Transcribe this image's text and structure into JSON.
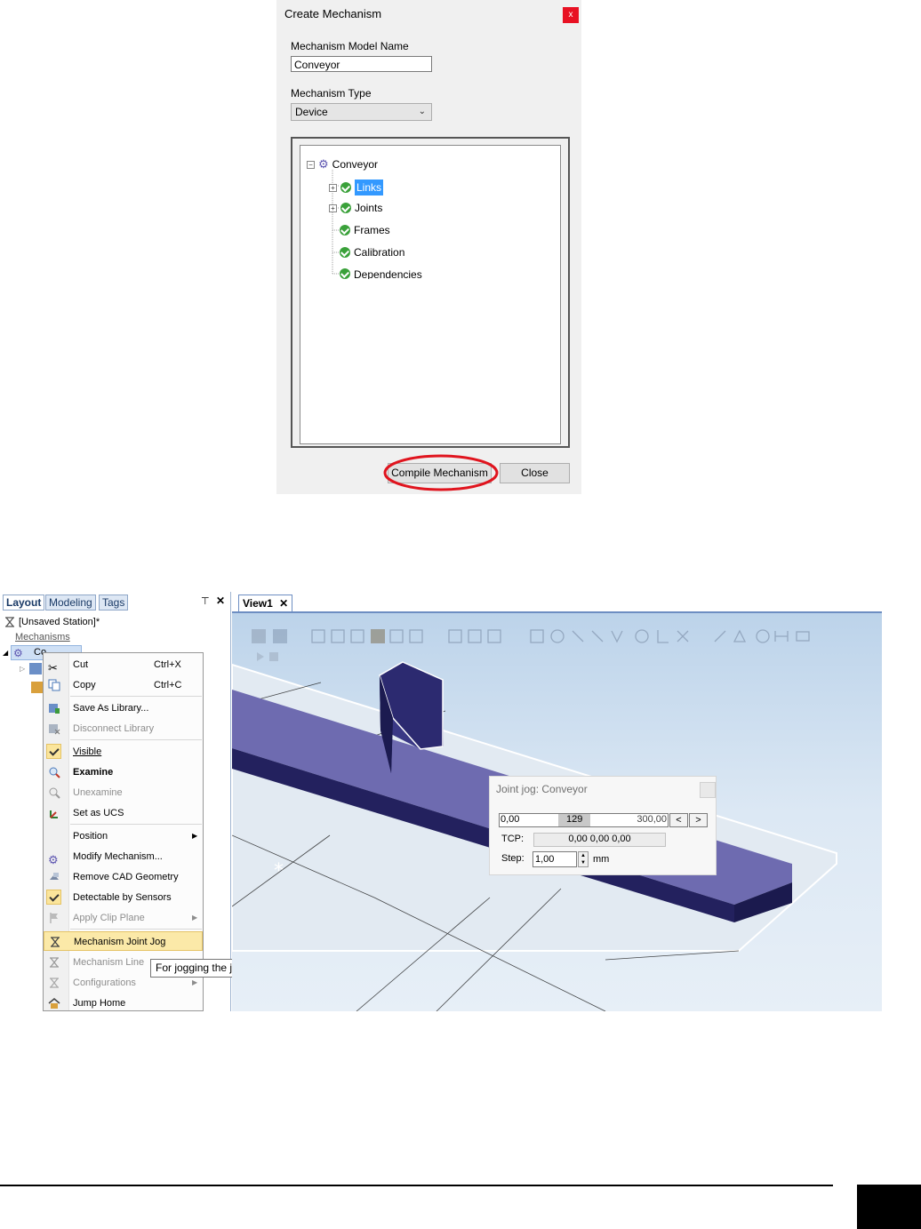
{
  "create_dialog": {
    "title": "Create Mechanism",
    "close_glyph": "x",
    "model_name_label": "Mechanism Model Name",
    "model_name_value": "Conveyor",
    "type_label": "Mechanism Type",
    "type_value": "Device",
    "tree": {
      "root": "Conveyor",
      "children": [
        {
          "label": "Links",
          "selected": true,
          "expandable": true
        },
        {
          "label": "Joints",
          "selected": false,
          "expandable": true
        },
        {
          "label": "Frames",
          "selected": false,
          "expandable": false
        },
        {
          "label": "Calibration",
          "selected": false,
          "expandable": false
        },
        {
          "label": "Dependencies",
          "selected": false,
          "expandable": false
        }
      ]
    },
    "compile_button": "Compile Mechanism",
    "close_button": "Close",
    "highlight_color": "#e0141e"
  },
  "layout_panel": {
    "tabs": [
      "Layout",
      "Modeling",
      "Tags"
    ],
    "pin_glyph": "⊤",
    "close_glyph": "✕",
    "station": "[Unsaved Station]*",
    "group": "Mechanisms",
    "selected_item": "Co"
  },
  "context_menu": {
    "items": [
      {
        "label": "Cut",
        "shortcut": "Ctrl+X",
        "icon": "scissors-icon"
      },
      {
        "label": "Copy",
        "shortcut": "Ctrl+C",
        "icon": "copy-icon"
      },
      {
        "label": "Save As Library...",
        "icon": "save-library-icon"
      },
      {
        "label": "Disconnect Library",
        "icon": "disconnect-library-icon",
        "disabled": true
      },
      {
        "label": "Visible",
        "checked": true
      },
      {
        "label": "Examine",
        "icon": "examine-icon",
        "bold": true
      },
      {
        "label": "Unexamine",
        "icon": "unexamine-icon",
        "disabled": true
      },
      {
        "label": "Set as UCS",
        "icon": "ucs-icon"
      },
      {
        "label": "Position",
        "submenu": true
      },
      {
        "label": "Modify Mechanism...",
        "icon": "mechanism-icon"
      },
      {
        "label": "Remove CAD Geometry",
        "icon": "remove-geometry-icon"
      },
      {
        "label": "Detectable by Sensors",
        "checked": true
      },
      {
        "label": "Apply Clip Plane",
        "icon": "flag-icon",
        "disabled": true,
        "submenu": true
      },
      {
        "label": "Mechanism Joint Jog",
        "icon": "joint-jog-icon",
        "highlighted": true
      },
      {
        "label": "Mechanism Line",
        "icon": "linear-jog-icon",
        "disabled": true
      },
      {
        "label": "Configurations",
        "icon": "configurations-icon",
        "disabled": true,
        "submenu": true
      },
      {
        "label": "Jump Home",
        "icon": "home-icon"
      }
    ],
    "tooltip": "For jogging the joints of a mechansim."
  },
  "view": {
    "tab_label": "View1",
    "tab_close": "✕",
    "joint_jog": {
      "title": "Joint jog: Conveyor",
      "min": "0,00",
      "value": "129",
      "max": "300,00",
      "prev_button": "<",
      "next_button": ">",
      "tcp_label": "TCP:",
      "tcp_value": "0,00 0,00 0,00",
      "step_label": "Step:",
      "step_value": "1,00",
      "step_unit": "mm"
    }
  }
}
